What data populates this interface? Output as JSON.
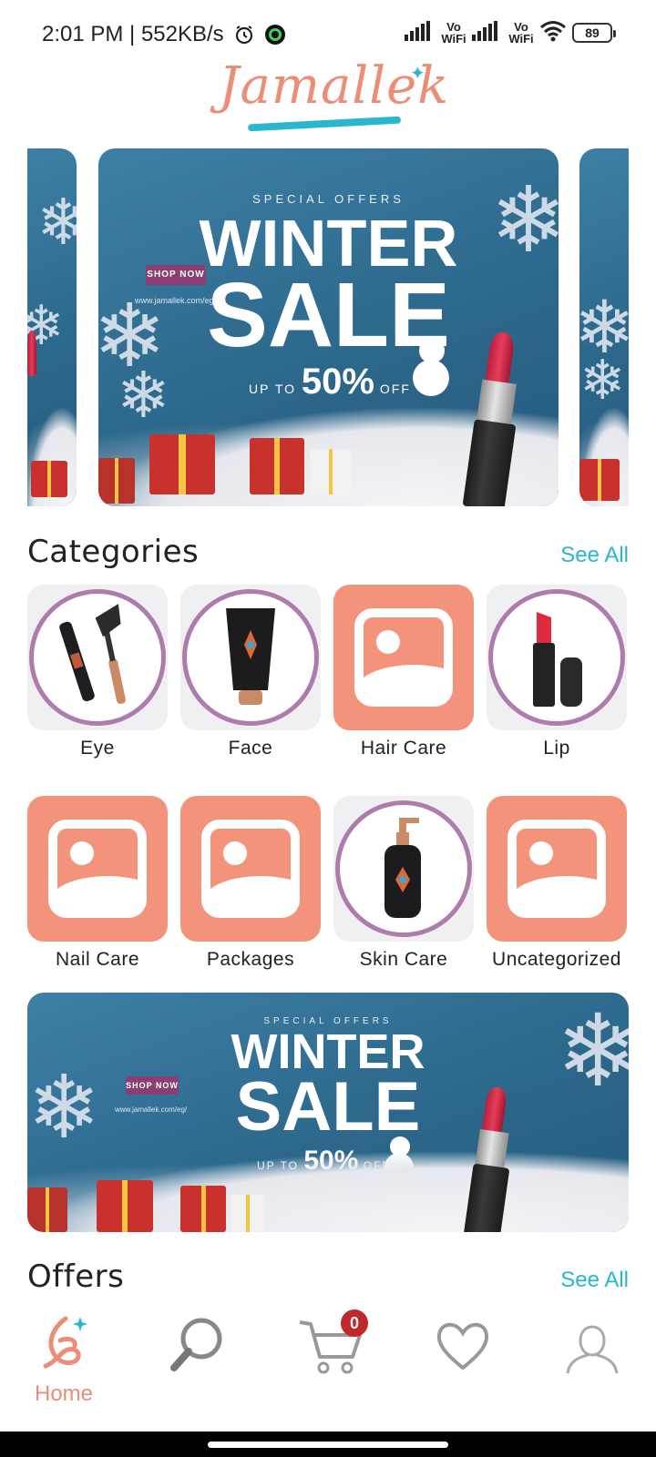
{
  "status_bar": {
    "time_speed": "2:01 PM | 552KB/s",
    "vowifi_1": "Vo WiFi",
    "vowifi_2": "Vo WiFi",
    "battery": "89",
    "icons": [
      "alarm-icon",
      "whatsapp-icon",
      "signal-icon",
      "wifi-icon",
      "battery-icon"
    ]
  },
  "logo": {
    "text": "Jamallek"
  },
  "banner": {
    "special": "SPECIAL OFFERS",
    "word1": "WINTER",
    "word2": "SALE",
    "shop_now": "SHOP NOW",
    "website": "www.jamallek.com/eg/",
    "up_to": "UP TO",
    "percent": "50%",
    "off": "OFF"
  },
  "categories": {
    "title": "Categories",
    "see_all": "See All",
    "items": [
      {
        "label": "Eye",
        "image": "mascara"
      },
      {
        "label": "Face",
        "image": "face-tube"
      },
      {
        "label": "Hair Care",
        "image": "placeholder"
      },
      {
        "label": "Lip",
        "image": "lipstick"
      },
      {
        "label": "Nail Care",
        "image": "placeholder"
      },
      {
        "label": "Packages",
        "image": "placeholder"
      },
      {
        "label": "Skin Care",
        "image": "pump-bottle"
      },
      {
        "label": "Uncategorized",
        "image": "placeholder"
      }
    ]
  },
  "offers": {
    "title": "Offers",
    "see_all": "See All"
  },
  "bottom_nav": {
    "home_label": "Home",
    "cart_count": "0",
    "items": [
      "home-icon",
      "search-icon",
      "cart-icon",
      "heart-icon",
      "profile-icon"
    ]
  },
  "colors": {
    "accent": "#29b6cf",
    "brand": "#ec8d77",
    "placeholder_tile": "#f3937b",
    "ring": "#ae7bad",
    "badge": "#c0282b"
  }
}
